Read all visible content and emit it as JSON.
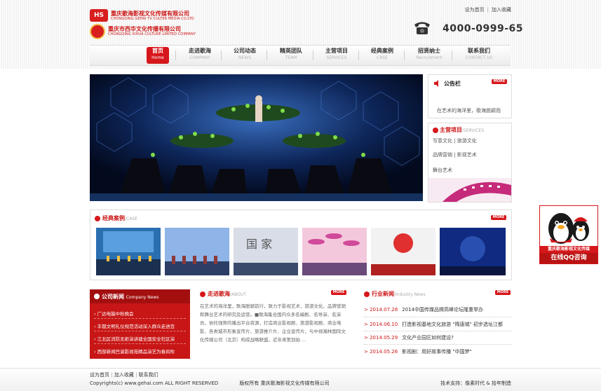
{
  "header": {
    "logo1_icon": "HS",
    "logo1_cn": "重庆歌海影视文化传媒有限公司",
    "logo1_en": "CHONGQING GEHAI TV CULTER MEDIA CO.LTD",
    "logo2_cn": "重庆市西华文化传播有限公司",
    "logo2_en": "CHONGQING XIHUA CULTURE LIMITED COMPANY",
    "top_links": [
      "设为首页",
      "加入收藏"
    ],
    "hotline": "4000-0999-65",
    "phone_icon": "telephone-icon"
  },
  "nav": [
    {
      "cn": "首页",
      "en": "Home",
      "active": true
    },
    {
      "cn": "走进歌海",
      "en": "COMPANY"
    },
    {
      "cn": "公司动态",
      "en": "NEWS"
    },
    {
      "cn": "精英团队",
      "en": "TEAM"
    },
    {
      "cn": "主营项目",
      "en": "SERVICES"
    },
    {
      "cn": "经典案例",
      "en": "CASE"
    },
    {
      "cn": "招贤纳士",
      "en": "Recruitment"
    },
    {
      "cn": "联系我们",
      "en": "CONTACT US"
    }
  ],
  "notice": {
    "title": "公告栏",
    "more": "MORE",
    "text": "在艺术的海洋里，歌海脱颖而",
    "icon": "speaker-icon"
  },
  "services": {
    "title": "主营项目",
    "title_en": "/SERVICES",
    "items": [
      "写意文化 | 旅游文化",
      "品牌营销 | 影视艺术",
      "舞台艺术"
    ]
  },
  "cases": {
    "title": "经典案例",
    "title_en": "/CASE",
    "more": "MORE",
    "thumb_text": "国 家"
  },
  "company_news": {
    "title": "公司新闻",
    "title_en": "Company News",
    "items": [
      "› 广达电脑中秋晚会",
      "› 丰都文明礼仪规范活动深入群众走进百",
      "› 江北区消防无拒演讲建全国安全社区演",
      "› 西部新闻巴渝影视苑精品演艺为春风吹"
    ]
  },
  "about": {
    "title": "走进歌海",
    "title_en": "/ABOUT",
    "more": "MORE",
    "text": "在艺术的海洋里，歌海脱颖前行，致力于影视艺术、旅游文化、品牌营销和舞台艺术的研究及运营。■歌海集合国内众多名编剧、名导演、名演员，依托强势的播出平台资源，打造商业影视剧、旅游影视剧、商业电影、各类城市形象宣传片、旅游推介片、企业宣传片，与中视瀚林国际文化传媒公司（北京）构成战略联盟，近年来策划拍 ..."
  },
  "industry_news": {
    "title": "行业新闻",
    "title_en": "/Industry News",
    "more": "MORE",
    "items": [
      {
        "date": "> 2014.07.28",
        "title": "2014中国传媒品牌高峰论坛隆重举办"
      },
      {
        "date": "> 2014.06.10",
        "title": "打造影视基地文化旅游 \"隋唐城\" 初步选址江都"
      },
      {
        "date": "> 2014.05.29",
        "title": "文化产业园区如何建设?"
      },
      {
        "date": "> 2014.05.26",
        "title": "影视剧：用好故事传播 \"中国梦\""
      }
    ]
  },
  "footer": {
    "links": [
      "设为首页",
      "加入收藏",
      "联系我们"
    ],
    "copyright": "Copyrights(c) www.gehai.com ALL RIGHT RESERVED",
    "owner": "版权所有 重庆歌海影视文化传媒有限公司",
    "tech": "技术支持：像素时代 & 拾年制造"
  },
  "qq": {
    "company": "重庆歌海影视文化传媒",
    "button": "在线QQ咨询",
    "icon": "penguin-icon"
  },
  "colors": {
    "brand_red": "#d6171b",
    "dark_red": "#a30f0f"
  }
}
